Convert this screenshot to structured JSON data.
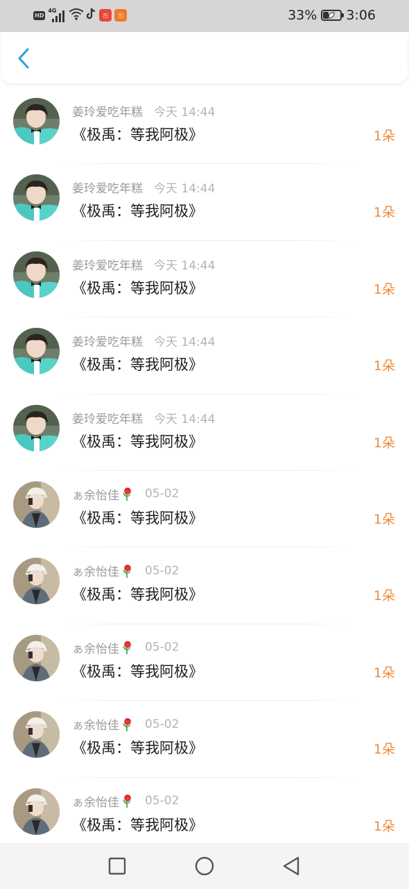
{
  "status_bar": {
    "hd_label": "HD",
    "network_label": "4G",
    "battery_percent": "33%",
    "battery_level": 0.33,
    "time": "3:06",
    "icons": [
      "hd-icon",
      "signal-icon",
      "wifi-icon",
      "tiktok-icon",
      "app-notification-icon",
      "app-notification-icon"
    ],
    "app_icon_glyph": "ஐ"
  },
  "nav": {
    "back_icon": "chevron-left-icon",
    "accent_color": "#2a9ee0"
  },
  "colors": {
    "count": "#ec8a3c",
    "name": "#9a9a9a",
    "time": "#b4b4b4",
    "title": "#1e1e1e"
  },
  "items": [
    {
      "user": "姜玲爱吃年糕",
      "time": "今天 14:44",
      "title": "《极禹：等我阿极》",
      "count": "1朵",
      "avatar": "avatar-a",
      "flower": false
    },
    {
      "user": "姜玲爱吃年糕",
      "time": "今天 14:44",
      "title": "《极禹：等我阿极》",
      "count": "1朵",
      "avatar": "avatar-a",
      "flower": false
    },
    {
      "user": "姜玲爱吃年糕",
      "time": "今天 14:44",
      "title": "《极禹：等我阿极》",
      "count": "1朵",
      "avatar": "avatar-a",
      "flower": false
    },
    {
      "user": "姜玲爱吃年糕",
      "time": "今天 14:44",
      "title": "《极禹：等我阿极》",
      "count": "1朵",
      "avatar": "avatar-a",
      "flower": false
    },
    {
      "user": "姜玲爱吃年糕",
      "time": "今天 14:44",
      "title": "《极禹：等我阿极》",
      "count": "1朵",
      "avatar": "avatar-a",
      "flower": false
    },
    {
      "user": "ぁ余怡佳",
      "time": "05-02",
      "title": "《极禹：等我阿极》",
      "count": "1朵",
      "avatar": "avatar-b",
      "flower": true
    },
    {
      "user": "ぁ余怡佳",
      "time": "05-02",
      "title": "《极禹：等我阿极》",
      "count": "1朵",
      "avatar": "avatar-b",
      "flower": true
    },
    {
      "user": "ぁ余怡佳",
      "time": "05-02",
      "title": "《极禹：等我阿极》",
      "count": "1朵",
      "avatar": "avatar-b",
      "flower": true
    },
    {
      "user": "ぁ余怡佳",
      "time": "05-02",
      "title": "《极禹：等我阿极》",
      "count": "1朵",
      "avatar": "avatar-b",
      "flower": true
    },
    {
      "user": "ぁ余怡佳",
      "time": "05-02",
      "title": "《极禹：等我阿极》",
      "count": "1朵",
      "avatar": "avatar-b",
      "flower": true
    }
  ],
  "system_nav": {
    "buttons": [
      "recents-square-icon",
      "home-circle-icon",
      "back-triangle-icon"
    ]
  }
}
